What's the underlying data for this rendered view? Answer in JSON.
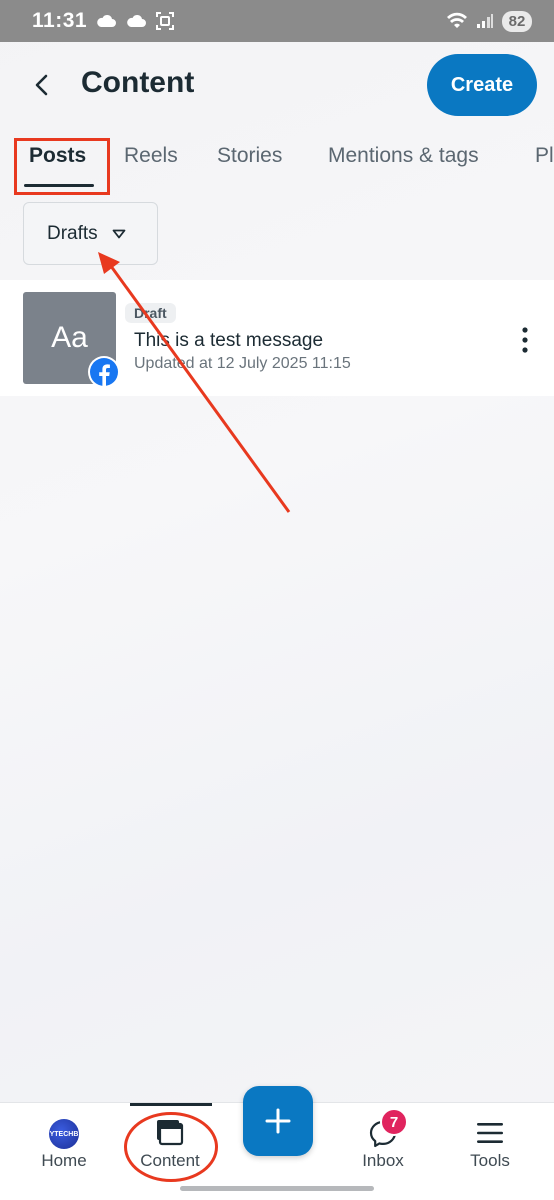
{
  "status_bar": {
    "time": "11:31",
    "battery": "82"
  },
  "header": {
    "title": "Content",
    "create_label": "Create"
  },
  "tabs": [
    {
      "label": "Posts"
    },
    {
      "label": "Reels"
    },
    {
      "label": "Stories"
    },
    {
      "label": "Mentions & tags"
    },
    {
      "label": "Pl"
    }
  ],
  "filter": {
    "selected": "Drafts"
  },
  "posts": [
    {
      "thumbnail_text": "Aa",
      "badge": "Draft",
      "title": "This is a test message",
      "updated": "Updated at 12 July 2025 11:15"
    }
  ],
  "bottom_nav": {
    "items": [
      {
        "label": "Home",
        "logo_text": "YTECHB"
      },
      {
        "label": "Content"
      },
      {
        "label": "Inbox",
        "badge": "7"
      },
      {
        "label": "Tools"
      }
    ]
  },
  "colors": {
    "accent": "#0a78c2",
    "annotation": "#e8391f",
    "badge": "#e0245e"
  }
}
